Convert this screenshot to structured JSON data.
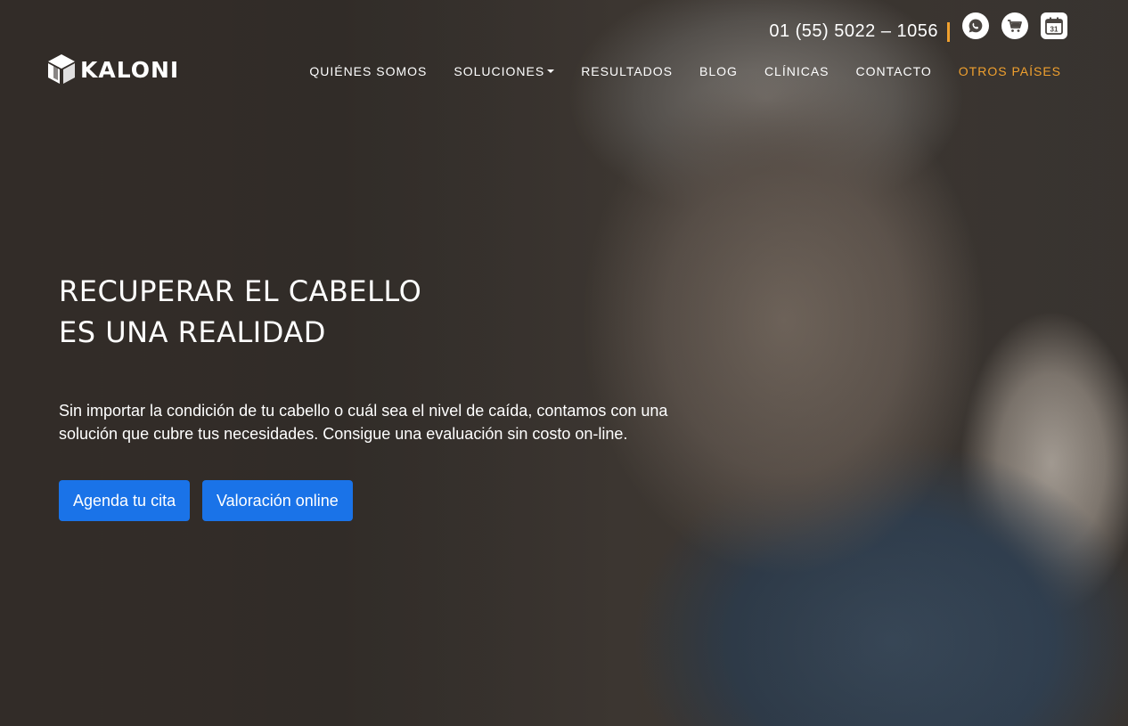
{
  "brand": {
    "name": "KALONI"
  },
  "topbar": {
    "phone": "01 (55) 5022 – 1056",
    "icons": [
      "whatsapp-icon",
      "cart-icon",
      "calendar-icon"
    ],
    "calendar_day": "31"
  },
  "nav": {
    "items": [
      {
        "label": "QUIÉNES SOMOS"
      },
      {
        "label": "SOLUCIONES"
      },
      {
        "label": "RESULTADOS"
      },
      {
        "label": "BLOG"
      },
      {
        "label": "CLÍNICAS"
      },
      {
        "label": "CONTACTO"
      },
      {
        "label": "OTROS PAÍSES"
      }
    ]
  },
  "hero": {
    "headline_line1": "RECUPERAR EL CABELLO",
    "headline_line2": "ES UNA REALIDAD",
    "subtext": "Sin importar la condición de tu cabello o cuál sea el nivel de caída, contamos con una solución que cubre tus necesidades. Consigue una evaluación sin costo on-line.",
    "cta_primary": "Agenda tu cita",
    "cta_secondary": "Valoración online"
  },
  "colors": {
    "accent": "#f0a02e",
    "button": "#1a73e8",
    "text": "#ffffff"
  }
}
